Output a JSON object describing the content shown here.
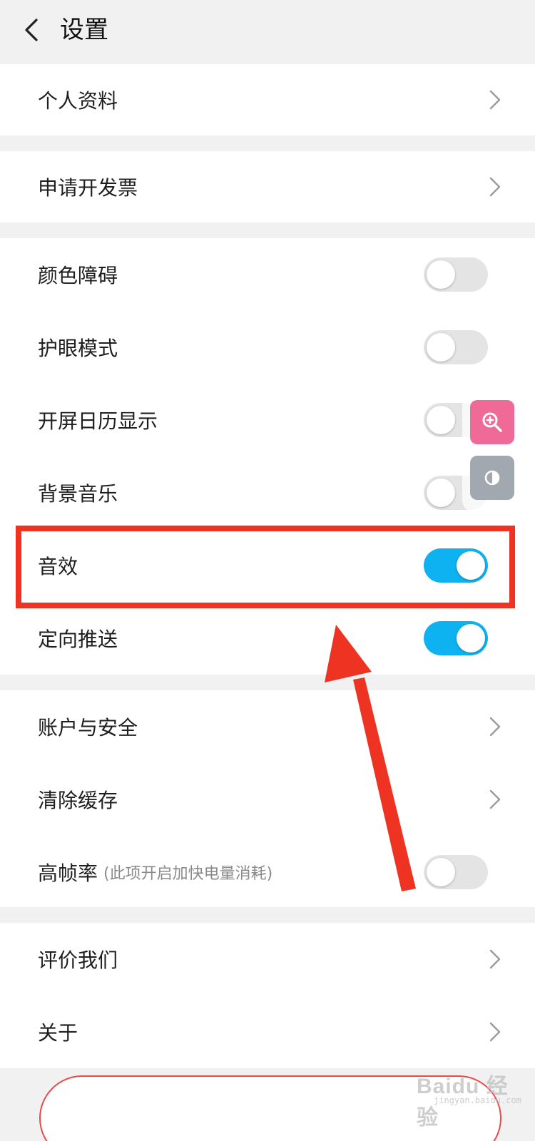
{
  "header": {
    "title": "设置",
    "back_icon": "chevron-left-icon"
  },
  "groups": [
    {
      "items": [
        {
          "label": "个人资料",
          "control": "chevron"
        }
      ]
    },
    {
      "items": [
        {
          "label": "申请开发票",
          "control": "chevron"
        }
      ]
    },
    {
      "items": [
        {
          "label": "颜色障碍",
          "control": "toggle",
          "on": false
        },
        {
          "label": "护眼模式",
          "control": "toggle",
          "on": false
        },
        {
          "label": "开屏日历显示",
          "control": "toggle",
          "on": false
        },
        {
          "label": "背景音乐",
          "control": "toggle",
          "on": false
        },
        {
          "label": "音效",
          "control": "toggle",
          "on": true
        },
        {
          "label": "定向推送",
          "control": "toggle",
          "on": true
        }
      ]
    },
    {
      "items": [
        {
          "label": "账户与安全",
          "control": "chevron"
        },
        {
          "label": "清除缓存",
          "control": "chevron"
        },
        {
          "label": "高帧率",
          "note": "(此项开启加快电量消耗)",
          "control": "toggle",
          "on": false
        }
      ]
    },
    {
      "items": [
        {
          "label": "评价我们",
          "control": "chevron"
        },
        {
          "label": "关于",
          "control": "chevron"
        }
      ]
    }
  ],
  "floating_tools": {
    "zoom_icon": "zoom-in-icon",
    "contrast_icon": "contrast-icon"
  },
  "annotation": {
    "highlight_color": "#ee3322",
    "highlighted_item": "音效"
  },
  "colors": {
    "toggle_on": "#0fb2f0",
    "toggle_off": "#e4e4e4",
    "zoom_button": "#f06a98",
    "contrast_button": "#a2a8b0"
  },
  "watermark": {
    "brand": "Baidu 经验",
    "sub": "jingyan.baidu.com"
  }
}
